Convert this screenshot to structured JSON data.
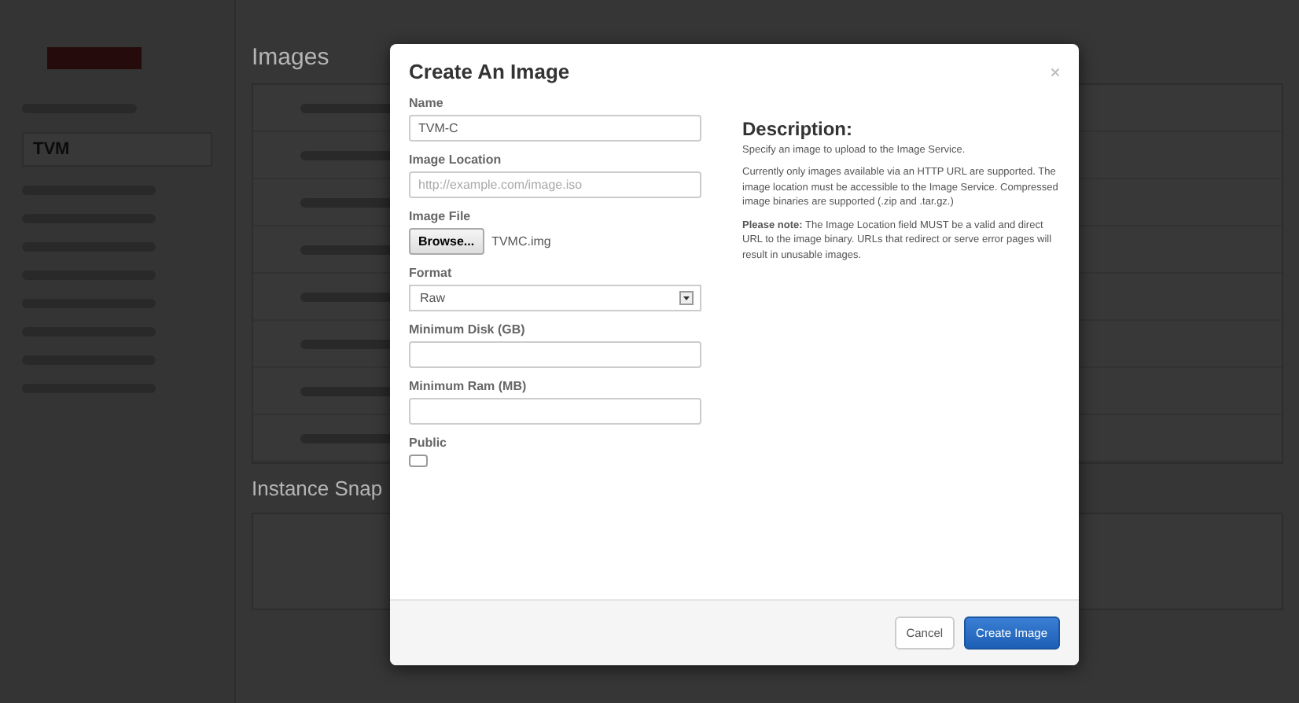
{
  "sidebar": {
    "project": "TVM"
  },
  "main": {
    "title": "Images",
    "section_2_title": "Instance Snap"
  },
  "modal": {
    "title": "Create An Image",
    "fields": [
      {
        "kind": "text",
        "label": "Name",
        "value": "TVM-C"
      },
      {
        "kind": "text",
        "label": "Image Location",
        "placeholder": "http://example.com/image.iso"
      },
      {
        "kind": "file",
        "label": "Image File",
        "button": "Browse...",
        "file_name": "TVMC.img"
      },
      {
        "kind": "select",
        "label": "Format",
        "value": "Raw"
      },
      {
        "kind": "text",
        "label": "Minimum Disk (GB)"
      },
      {
        "kind": "text",
        "label": "Minimum Ram (MB)"
      },
      {
        "kind": "checkbox",
        "label": "Public",
        "checked": false
      }
    ],
    "description": {
      "heading": "Description:",
      "paragraphs": [
        "Specify an image to upload to the Image Service.",
        "Currently only images available via an HTTP URL are supported. The image location must be accessible to the Image Service. Compressed image binaries are supported (.zip and .tar.gz.)",
        "**Please note:** The Image Location field MUST be a valid and direct URL to the image binary. URLs that redirect or serve error pages will result in unusable images."
      ]
    },
    "buttons": [
      {
        "kind": "secondary",
        "label": "Cancel"
      },
      {
        "kind": "primary",
        "label": "Create Image"
      }
    ]
  }
}
